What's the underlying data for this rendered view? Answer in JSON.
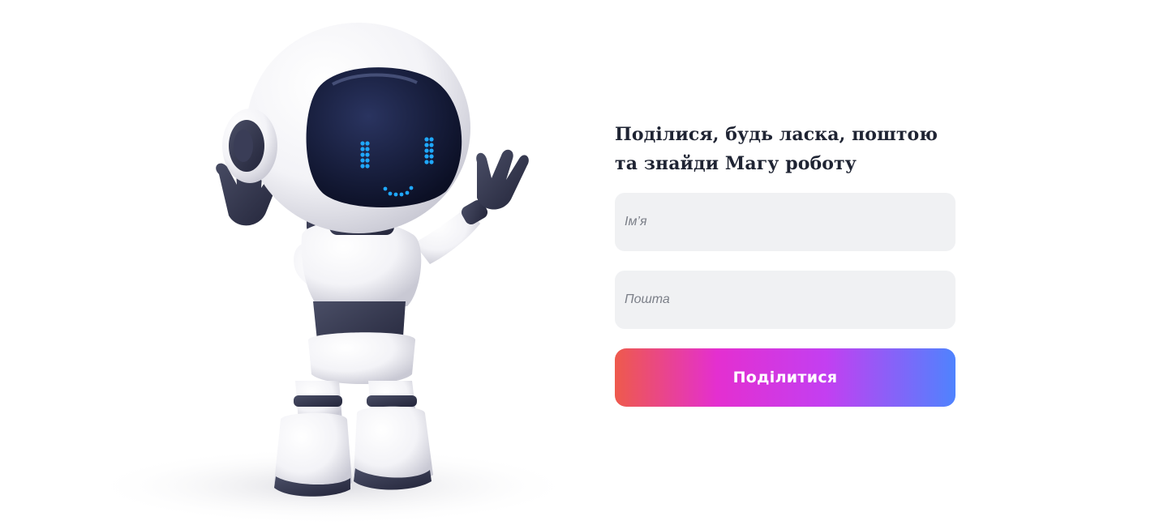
{
  "form": {
    "title_line1": "Поділися, будь ласка, поштою",
    "title_line2": "та знайди Магу роботу",
    "name_placeholder": "Ім’я",
    "email_placeholder": "Пошта",
    "submit_label": "Поділитися"
  },
  "colors": {
    "gradient_start": "#ee5a4c",
    "gradient_mid": "#e42fd0",
    "gradient_end": "#4f83fe",
    "field_background": "#f0f1f3",
    "title_text": "#1f2433",
    "robot_face_led": "#1fa8ff"
  },
  "icons": {
    "mascot": "robot-mascot-illustration"
  }
}
